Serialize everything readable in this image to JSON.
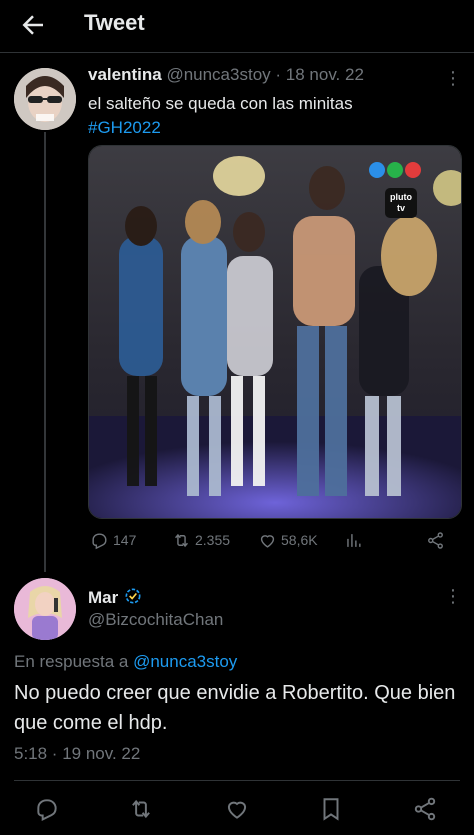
{
  "header": {
    "title": "Tweet"
  },
  "main_tweet": {
    "display_name": "valentina",
    "handle": "@nunca3stoy",
    "date": "· 18 nov. 22",
    "text": "el salteño se queda con las minitas",
    "hashtag": "#GH2022",
    "media_watermark": "pluto tv",
    "stats": {
      "replies": "147",
      "retweets": "2.355",
      "likes": "58,6K"
    }
  },
  "reply_tweet": {
    "display_name": "Mar",
    "handle": "@BizcochitaChan",
    "in_reply_prefix": "En respuesta a",
    "in_reply_handle": "@nunca3stoy",
    "text": "No puedo creer que envidie a Robertito. Que bien que come el hdp.",
    "timestamp": "5:18 · 19 nov. 22"
  },
  "colors": {
    "background": "#000000",
    "accent": "#1d9bf0",
    "muted": "#71767b",
    "text": "#e7e9ea",
    "divider": "#2f3336"
  },
  "icons": [
    "back-arrow-icon",
    "more-icon",
    "reply-icon",
    "retweet-icon",
    "like-icon",
    "analytics-icon",
    "share-icon",
    "bookmark-icon",
    "verified-badge-icon"
  ]
}
